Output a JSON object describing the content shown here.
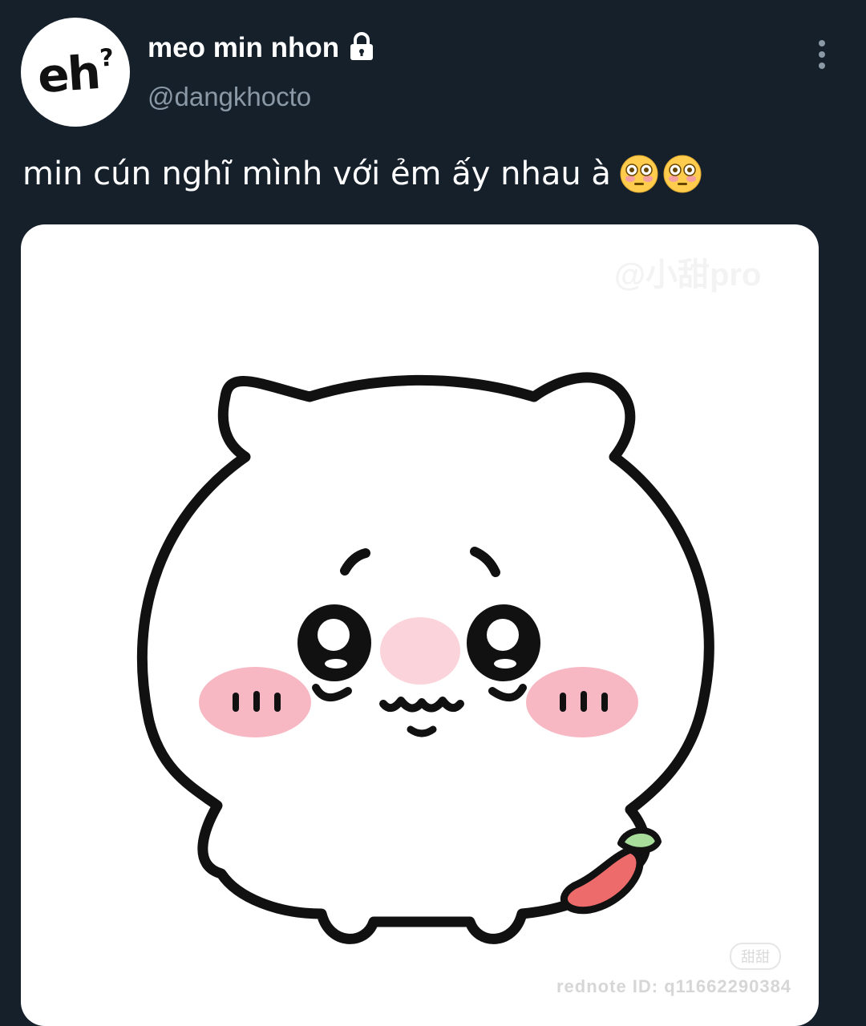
{
  "user": {
    "avatar_text": "eh",
    "avatar_mark": "?",
    "display_name": "meo min nhon",
    "lock_icon": "lock-icon",
    "handle": "@dangkhocto"
  },
  "tweet": {
    "text": "min cún nghĩ mình với ẻm ấy nhau à",
    "emojis": [
      "flushed-face",
      "flushed-face"
    ]
  },
  "media": {
    "watermark_top": "@小甜pro",
    "watermark_badge": "甜甜",
    "watermark_id": "rednote ID: q11662290384"
  },
  "colors": {
    "background": "#15202b",
    "secondary_text": "#8b98a5",
    "blush": "#f7b8c3",
    "nose": "#fbd3da",
    "pepper_red": "#ee6b6b",
    "pepper_green": "#a8dc9b"
  }
}
